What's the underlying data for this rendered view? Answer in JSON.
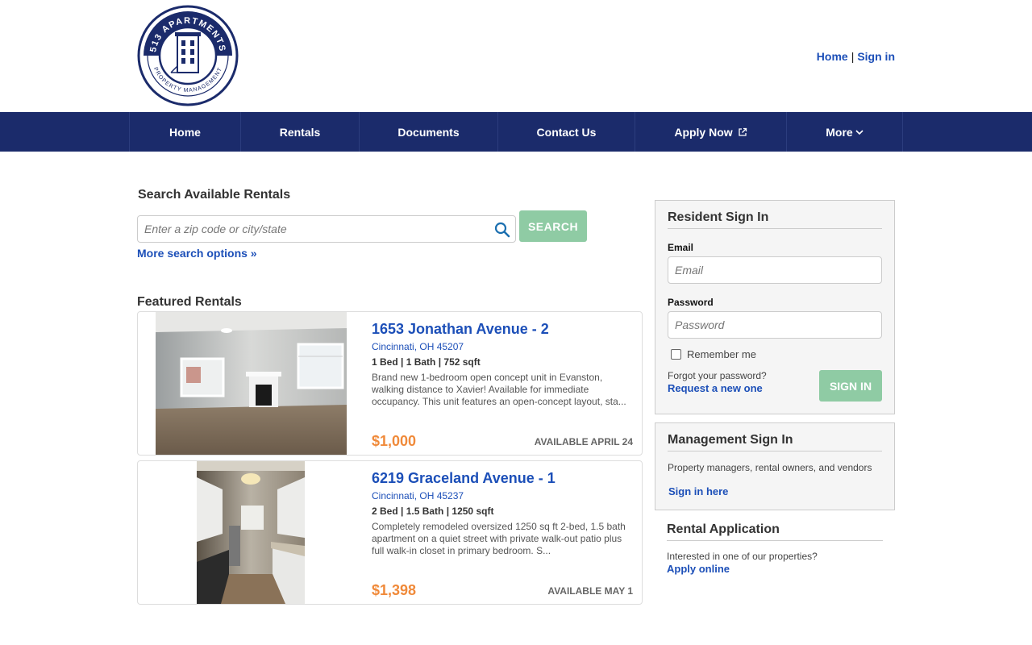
{
  "logo": {
    "ring_top": "513 APARTMENTS",
    "ring_bottom": "PROPERTY MANAGEMENT",
    "color": "#1b2b6b"
  },
  "toplinks": {
    "home": "Home",
    "separator": "|",
    "signin": "Sign in"
  },
  "nav": {
    "items": [
      {
        "label": "Home"
      },
      {
        "label": "Rentals"
      },
      {
        "label": "Documents"
      },
      {
        "label": "Contact Us"
      },
      {
        "label": "Apply Now",
        "icon": "external-link-icon"
      },
      {
        "label": "More",
        "icon": "chevron-down-icon"
      }
    ],
    "background": "#1b2b6b"
  },
  "search": {
    "title": "Search Available Rentals",
    "placeholder": "Enter a zip code or city/state",
    "button": "SEARCH",
    "more_options": "More search options »"
  },
  "featured": {
    "title": "Featured Rentals",
    "listings": [
      {
        "address": "1653 Jonathan Avenue - 2",
        "city": "Cincinnati, OH 45207",
        "specs": "1 Bed | 1 Bath | 752 sqft",
        "description": "Brand new 1-bedroom open concept unit in Evanston, walking distance to Xavier! Available for immediate occupancy. This unit features an open-concept layout, sta...",
        "price": "$1,000",
        "available": "AVAILABLE APRIL 24"
      },
      {
        "address": "6219 Graceland Avenue - 1",
        "city": "Cincinnati, OH 45237",
        "specs": "2 Bed | 1.5 Bath | 1250 sqft",
        "description": "Completely remodeled oversized 1250 sq ft 2-bed, 1.5 bath apartment on a quiet street with private walk-out patio plus full walk-in closet in primary bedroom. S...",
        "price": "$1,398",
        "available": "AVAILABLE MAY 1"
      }
    ]
  },
  "resident": {
    "title": "Resident Sign In",
    "email_label": "Email",
    "email_placeholder": "Email",
    "password_label": "Password",
    "password_placeholder": "Password",
    "remember": "Remember me",
    "forgot": "Forgot your password?",
    "request": "Request a new one",
    "button": "SIGN IN"
  },
  "management": {
    "title": "Management Sign In",
    "text": "Property managers, rental owners, and vendors",
    "link": "Sign in here"
  },
  "application": {
    "title": "Rental Application",
    "text": "Interested in one of our properties?",
    "link": "Apply online"
  },
  "colors": {
    "accent_blue": "#1c4fb8",
    "price_orange": "#f08a3a",
    "button_green": "#8fcba4"
  }
}
